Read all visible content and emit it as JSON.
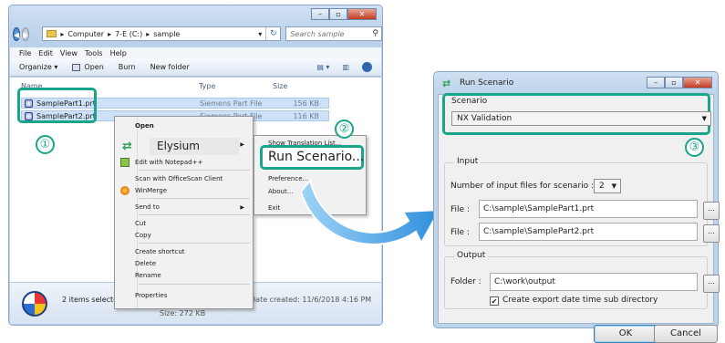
{
  "explorer": {
    "breadcrumb": [
      "Computer",
      "7-E (C:)",
      "sample"
    ],
    "search_placeholder": "Search sample",
    "menu": [
      "File",
      "Edit",
      "View",
      "Tools",
      "Help"
    ],
    "toolbar": [
      "Organize ▾",
      "Open",
      "Burn",
      "New folder"
    ],
    "columns": [
      "Name",
      "Type",
      "Size"
    ],
    "files": [
      {
        "name": "SamplePart1.prt",
        "type": "Siemens Part File",
        "size": "156 KB"
      },
      {
        "name": "SamplePart2.prt",
        "type": "Siemens Part File",
        "size": "116 KB"
      }
    ],
    "status": {
      "selected": "2 items selected",
      "date": "Date created: 11/6/2018 4:16 PM",
      "size": "Size: 272 KB"
    }
  },
  "context_menu": {
    "open": "Open",
    "elysium": "Elysium",
    "items": [
      "Edit with Notepad++",
      "Scan with OfficeScan Client",
      "WinMerge",
      "Send to",
      "Cut",
      "Copy",
      "Create shortcut",
      "Delete",
      "Rename",
      "Properties"
    ]
  },
  "submenu": {
    "show_translation": "Show Translation List...",
    "run_scenario": "Run Scenario...",
    "preference": "Preference...",
    "about": "About...",
    "exit": "Exit"
  },
  "badges": [
    "①",
    "②",
    "③"
  ],
  "dialog": {
    "title": "Run Scenario",
    "scenario_label": "Scenario",
    "scenario_value": "NX Validation",
    "input_label": "Input",
    "num_files_label": "Number of input files for scenario :",
    "num_files_value": "2",
    "file_label": "File :",
    "file1": "C:\\sample\\SamplePart1.prt",
    "file2": "C:\\sample\\SamplePart2.prt",
    "browse": "...",
    "output_label": "Output",
    "folder_label": "Folder :",
    "folder_value": "C:\\work\\output",
    "checkbox_label": "Create export date time sub directory",
    "ok": "OK",
    "cancel": "Cancel"
  },
  "colors": {
    "highlight": "#19a58a",
    "arrow": "#3b9be0"
  }
}
